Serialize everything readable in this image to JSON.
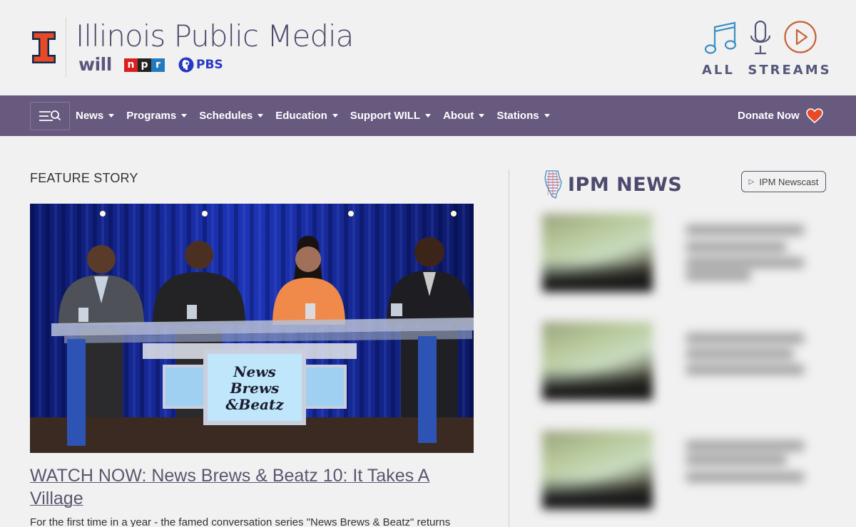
{
  "header": {
    "site_title": "Illinois Public Media",
    "will_label": "will",
    "npr_letters": [
      "n",
      "p",
      "r"
    ],
    "npr_colors": [
      "#d62021",
      "#222222",
      "#237bbd"
    ],
    "pbs_label": "PBS",
    "streams_label": "ALL  STREAMS",
    "brand_color": "#4d4a6d",
    "illini_orange": "#e84a27"
  },
  "nav": {
    "items": [
      {
        "label": "News"
      },
      {
        "label": "Programs"
      },
      {
        "label": "Schedules"
      },
      {
        "label": "Education"
      },
      {
        "label": "Support WILL"
      },
      {
        "label": "About"
      },
      {
        "label": "Stations"
      }
    ],
    "donate_label": "Donate Now",
    "background": "#68597f"
  },
  "feature": {
    "section_label": "FEATURE STORY",
    "title": "WATCH NOW: News Brews & Beatz 10: It Takes A Village",
    "description": "For the first time in a year - the famed conversation series \"News Brews & Beatz\" returns",
    "desk_sign_lines": [
      "News",
      "Brews",
      "&Beatz"
    ]
  },
  "sidebar": {
    "heading": "IPM NEWS",
    "newscast_label": "IPM Newscast"
  }
}
